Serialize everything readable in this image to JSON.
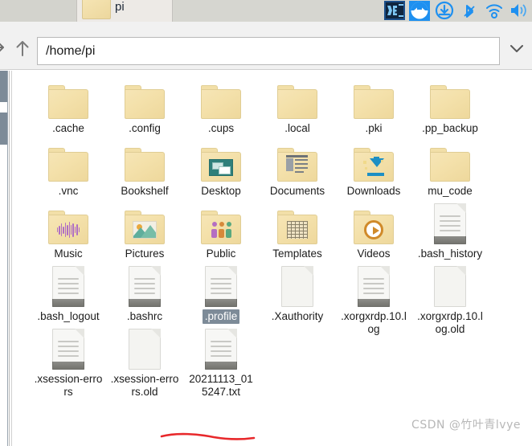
{
  "window": {
    "tab_label": "pi",
    "tab_icon": "folder-icon"
  },
  "tray": {
    "icons": [
      {
        "name": "vscode-icon",
        "label": "VS"
      },
      {
        "name": "teamviewer-icon",
        "label": "TV"
      },
      {
        "name": "update-icon",
        "label": "Update"
      },
      {
        "name": "bluetooth-icon",
        "label": "Bluetooth"
      },
      {
        "name": "wifi-icon",
        "label": "Wi-Fi"
      },
      {
        "name": "volume-icon",
        "label": "Volume"
      }
    ]
  },
  "toolbar": {
    "forward_label": "Forward",
    "up_label": "Up one level",
    "path_value": "/home/pi",
    "path_placeholder": "/home/pi",
    "dropdown_label": "Path history"
  },
  "files": {
    "columns": 6,
    "items": [
      {
        "name": ".cache",
        "type": "folder",
        "overlay": "none",
        "selected": false
      },
      {
        "name": ".config",
        "type": "folder",
        "overlay": "none",
        "selected": false
      },
      {
        "name": ".cups",
        "type": "folder",
        "overlay": "none",
        "selected": false
      },
      {
        "name": ".local",
        "type": "folder",
        "overlay": "none",
        "selected": false
      },
      {
        "name": ".pki",
        "type": "folder",
        "overlay": "none",
        "selected": false
      },
      {
        "name": ".pp_backup",
        "type": "folder",
        "overlay": "none",
        "selected": false
      },
      {
        "name": ".vnc",
        "type": "folder",
        "overlay": "none",
        "selected": false
      },
      {
        "name": "Bookshelf",
        "type": "folder",
        "overlay": "none",
        "selected": false
      },
      {
        "name": "Desktop",
        "type": "folder",
        "overlay": "desktop",
        "selected": false
      },
      {
        "name": "Documents",
        "type": "folder",
        "overlay": "documents",
        "selected": false
      },
      {
        "name": "Downloads",
        "type": "folder",
        "overlay": "downloads",
        "selected": false
      },
      {
        "name": "mu_code",
        "type": "folder",
        "overlay": "none",
        "selected": false
      },
      {
        "name": "Music",
        "type": "folder",
        "overlay": "music",
        "selected": false
      },
      {
        "name": "Pictures",
        "type": "folder",
        "overlay": "pictures",
        "selected": false
      },
      {
        "name": "Public",
        "type": "folder",
        "overlay": "public",
        "selected": false
      },
      {
        "name": "Templates",
        "type": "folder",
        "overlay": "templates",
        "selected": false
      },
      {
        "name": "Videos",
        "type": "folder",
        "overlay": "videos",
        "selected": false
      },
      {
        "name": ".bash_history",
        "type": "document",
        "overlay": "none",
        "selected": false
      },
      {
        "name": ".bash_logout",
        "type": "document",
        "overlay": "none",
        "selected": false
      },
      {
        "name": ".bashrc",
        "type": "document",
        "overlay": "none",
        "selected": false
      },
      {
        "name": ".profile",
        "type": "document",
        "overlay": "none",
        "selected": true
      },
      {
        "name": ".Xauthority",
        "type": "blank",
        "overlay": "none",
        "selected": false
      },
      {
        "name": ".xorgxrdp.10.log",
        "type": "document",
        "overlay": "none",
        "selected": false
      },
      {
        "name": ".xorgxrdp.10.log.old",
        "type": "blank",
        "overlay": "none",
        "selected": false
      },
      {
        "name": ".xsession-errors",
        "type": "document",
        "overlay": "none",
        "selected": false
      },
      {
        "name": ".xsession-errors.old",
        "type": "blank",
        "overlay": "none",
        "selected": false
      },
      {
        "name": "20211113_015247.txt",
        "type": "document",
        "overlay": "none",
        "selected": false
      }
    ]
  },
  "annotation": {
    "name": "red-underline",
    "color": "#e8282b",
    "target": "20211113_015247.txt"
  },
  "watermark": {
    "prefix": "CSDN @",
    "user": "竹叶青lvye"
  },
  "colors": {
    "folder": "#f2dfa8",
    "selection": "#7d8b98",
    "tray_blue": "#1e90f0",
    "accent_red": "#e8282b",
    "toolbar_bg": "#f1f1f1",
    "tabstrip_bg": "#d6d6d0"
  }
}
